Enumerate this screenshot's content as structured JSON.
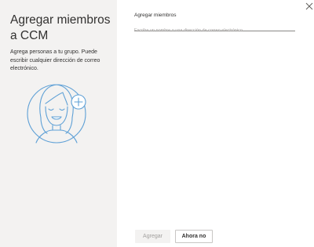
{
  "panel": {
    "title": "Agregar miembros a CCM",
    "description": "Agrega personas a tu grupo. Puede escribir cualquier dirección de correo electrónico."
  },
  "form": {
    "members_label": "Agregar miembros",
    "members_placeholder": "Escriba un nombre o una dirección de correo electrónico",
    "members_value": ""
  },
  "buttons": {
    "add_label": "Agregar",
    "cancel_label": "Ahora no"
  },
  "icons": {
    "close": "close-icon",
    "illustration": "person-add-illustration"
  },
  "colors": {
    "left_panel_bg": "#f3f2f1",
    "illustration_stroke": "#5ea0d6",
    "disabled_text": "#a19f9d"
  }
}
